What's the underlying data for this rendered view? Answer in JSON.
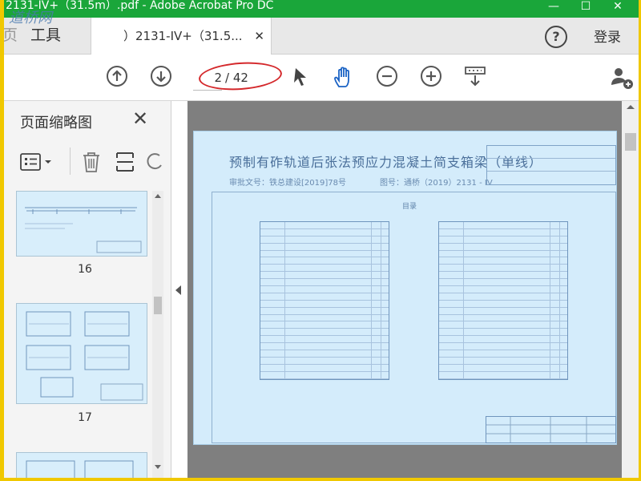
{
  "window": {
    "title": "2131-IV+（31.5m）.pdf - Adobe Acrobat Pro DC",
    "watermark": "道桥网",
    "minimize_glyph": "—",
    "maximize_glyph": "☐",
    "close_glyph": "✕"
  },
  "tabs": {
    "tools_label": "工具",
    "tools_edge_glyph": "页",
    "doc_tab_label": "）2131-IV+（31.5...",
    "doc_tab_close": "✕"
  },
  "header_right": {
    "help_glyph": "?",
    "login_label": "登录"
  },
  "toolbar": {
    "current_page": "2",
    "total_pages": "/ 42",
    "icons": [
      "prev-page-icon",
      "next-page-icon",
      "select-arrow-icon",
      "hand-tool-icon",
      "zoom-out-icon",
      "zoom-in-icon",
      "scroll-mode-icon",
      "add-user-icon"
    ]
  },
  "panel": {
    "title": "页面缩略图",
    "close_glyph": "✕",
    "thumbnails": [
      {
        "number": "16"
      },
      {
        "number": "17"
      }
    ]
  },
  "document": {
    "drawing_title": "预制有砟轨道后张法预应力混凝土简支箱梁（单线）",
    "sub_left": "审批文号：铁总建设[2019]78号",
    "sub_right": "图号：通桥（2019）2131 - IV",
    "toc_heading": "目录"
  },
  "colors": {
    "accent_green": "#1aa63a",
    "outer_border": "#f0c800",
    "annotation_red": "#d4282b",
    "page_blue": "#d4ecfb"
  }
}
